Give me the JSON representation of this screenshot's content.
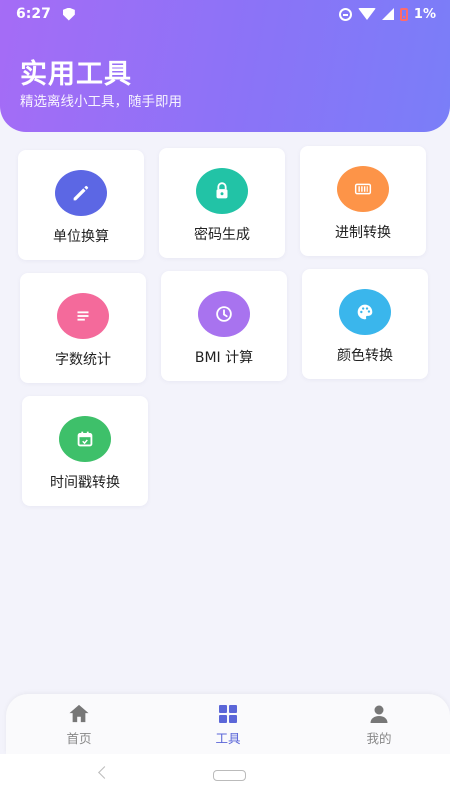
{
  "status_bar": {
    "time": "6:27",
    "battery": "1%"
  },
  "header": {
    "title": "实用工具",
    "subtitle": "精选离线小工具，随手即用"
  },
  "tools": [
    {
      "label": "单位换算",
      "icon": "pencil-icon",
      "color": "#5c67e4"
    },
    {
      "label": "密码生成",
      "icon": "lock-icon",
      "color": "#22c3a6"
    },
    {
      "label": "进制转换",
      "icon": "barcode-icon",
      "color": "#fd9448"
    },
    {
      "label": "字数统计",
      "icon": "text-lines-icon",
      "color": "#f46a9b"
    },
    {
      "label": "BMI 计算",
      "icon": "clock-icon",
      "color": "#a873ef"
    },
    {
      "label": "颜色转换",
      "icon": "palette-icon",
      "color": "#3ab6ec"
    },
    {
      "label": "时间戳转换",
      "icon": "calendar-icon",
      "color": "#3ec06a"
    }
  ],
  "nav": [
    {
      "label": "首页",
      "icon": "home-icon",
      "active": false
    },
    {
      "label": "工具",
      "icon": "grid-icon",
      "active": true
    },
    {
      "label": "我的",
      "icon": "person-icon",
      "active": false
    }
  ],
  "colors": {
    "header_start": "#a56cf6",
    "header_end": "#7a7ef8",
    "active_nav": "#5b66d8"
  }
}
